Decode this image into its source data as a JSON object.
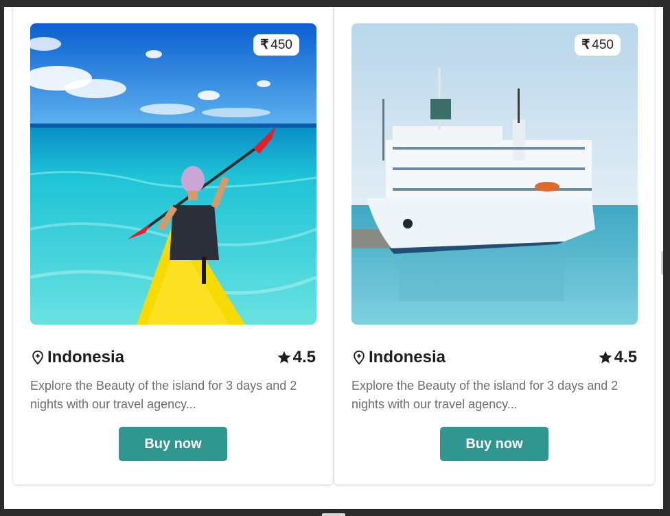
{
  "cards": [
    {
      "image_alt": "kayaker in turquoise sea",
      "price_symbol": "₹",
      "price": "450",
      "title": "Indonesia",
      "rating": "4.5",
      "description": "Explore the Beauty of the island for 3 days and 2 nights with our travel agency...",
      "button_label": "Buy now"
    },
    {
      "image_alt": "white passenger ship at harbour",
      "price_symbol": "₹",
      "price": "450",
      "title": "Indonesia",
      "rating": "4.5",
      "description": "Explore the Beauty of the island for 3 days and 2 nights with our travel agency...",
      "button_label": "Buy now"
    }
  ],
  "theme": {
    "button_color": "#2f9690",
    "title_color": "#1d1d1d",
    "description_color": "#6d6d6d"
  },
  "icons": {
    "location": "map-pin-icon",
    "rating": "star-icon"
  }
}
